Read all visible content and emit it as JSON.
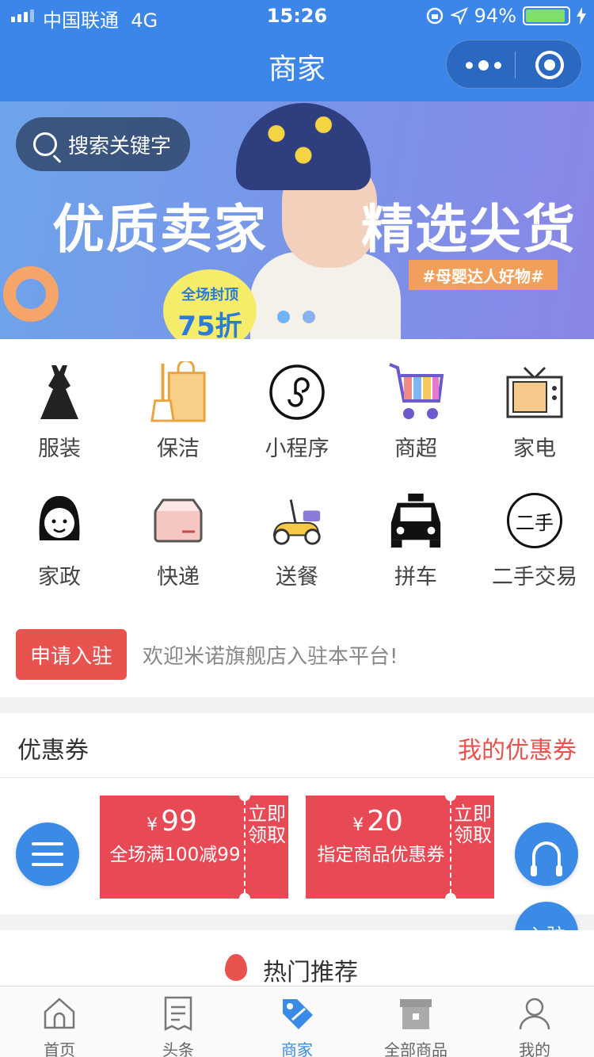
{
  "status": {
    "carrier": "中国联通",
    "network": "4G",
    "time": "15:26",
    "battery": "94%",
    "battery_level": 0.94
  },
  "nav": {
    "title": "商家"
  },
  "banner": {
    "search_placeholder": "搜索关键字",
    "headline_left": "优质卖家",
    "headline_right": "精选尖货",
    "tag": "#母婴达人好物#",
    "badge_line1": "全场封顶",
    "badge_line2": "75折",
    "slide_count": 2
  },
  "categories": [
    {
      "label": "服装",
      "icon": "dress-icon"
    },
    {
      "label": "保洁",
      "icon": "broom-bag-icon"
    },
    {
      "label": "小程序",
      "icon": "mini-program-icon"
    },
    {
      "label": "商超",
      "icon": "shopping-cart-icon"
    },
    {
      "label": "家电",
      "icon": "tv-icon"
    },
    {
      "label": "家政",
      "icon": "housekeeper-icon"
    },
    {
      "label": "快递",
      "icon": "parcel-box-icon"
    },
    {
      "label": "送餐",
      "icon": "scooter-icon"
    },
    {
      "label": "拼车",
      "icon": "taxi-icon"
    },
    {
      "label": "二手交易",
      "icon": "second-hand-icon"
    }
  ],
  "second_hand_icon_text": "二手",
  "notice": {
    "button": "申请入驻",
    "text": "欢迎米诺旗舰店入驻本平台!"
  },
  "coupons": {
    "title": "优惠券",
    "my_link": "我的优惠券",
    "items": [
      {
        "currency": "¥",
        "amount": "99",
        "desc": "全场满100减99",
        "action": "立即领取"
      },
      {
        "currency": "¥",
        "amount": "20",
        "desc": "指定商品优惠券",
        "action": "立即领取"
      }
    ]
  },
  "fab": {
    "join": "入驻"
  },
  "hot": {
    "title": "热门推荐"
  },
  "tabbar": [
    {
      "label": "首页",
      "icon": "home-icon",
      "active": false
    },
    {
      "label": "头条",
      "icon": "news-icon",
      "active": false
    },
    {
      "label": "商家",
      "icon": "merchant-tag-icon",
      "active": true
    },
    {
      "label": "全部商品",
      "icon": "box-icon",
      "active": false
    },
    {
      "label": "我的",
      "icon": "user-icon",
      "active": false
    }
  ],
  "colors": {
    "primary": "#3b86e8",
    "accent": "#e9534f",
    "coupon": "#e84a55"
  }
}
